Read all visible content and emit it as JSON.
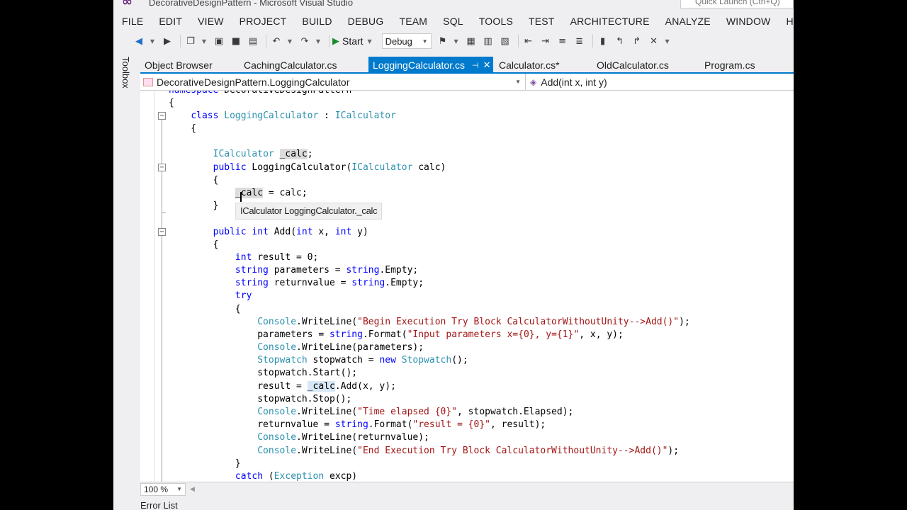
{
  "window": {
    "title": "DecorativeDesignPattern - Microsoft Visual Studio",
    "quick_launch_placeholder": "Quick Launch (Ctrl+Q)"
  },
  "menu": [
    "FILE",
    "EDIT",
    "VIEW",
    "PROJECT",
    "BUILD",
    "DEBUG",
    "TEAM",
    "SQL",
    "TOOLS",
    "TEST",
    "ARCHITECTURE",
    "ANALYZE",
    "WINDOW",
    "HELP"
  ],
  "toolbar": {
    "start_label": "Start",
    "configuration": "Debug"
  },
  "toolbox": {
    "label": "Toolbox"
  },
  "tabs": [
    {
      "label": "Object Browser",
      "active": false
    },
    {
      "label": "CachingCalculator.cs",
      "active": false
    },
    {
      "label": "LoggingCalculator.cs",
      "active": true
    },
    {
      "label": "Calculator.cs*",
      "active": false
    },
    {
      "label": "OldCalculator.cs",
      "active": false
    },
    {
      "label": "Program.cs",
      "active": false
    }
  ],
  "navbar": {
    "type_selector": "DecorativeDesignPattern.LoggingCalculator",
    "member_selector": "Add(int x, int y)"
  },
  "editor": {
    "lines": [
      "namespace DecorativeDesignPattern",
      "{",
      "    class LoggingCalculator : ICalculator",
      "    {",
      "",
      "        ICalculator _calc;",
      "        public LoggingCalculator(ICalculator calc)",
      "        {",
      "            _calc = calc;",
      "        }",
      "",
      "        public int Add(int x, int y)",
      "        {",
      "            int result = 0;",
      "            string parameters = string.Empty;",
      "            string returnvalue = string.Empty;",
      "            try",
      "            {",
      "                Console.WriteLine(\"Begin Execution Try Block CalculatorWithoutUnity-->Add()\");",
      "                parameters = string.Format(\"Input parameters x={0}, y={1}\", x, y);",
      "                Console.WriteLine(parameters);",
      "                Stopwatch stopwatch = new Stopwatch();",
      "                stopwatch.Start();",
      "                result = _calc.Add(x, y);",
      "                stopwatch.Stop();",
      "                Console.WriteLine(\"Time elapsed {0}\", stopwatch.Elapsed);",
      "                returnvalue = string.Format(\"result = {0}\", result);",
      "                Console.WriteLine(returnvalue);",
      "                Console.WriteLine(\"End Execution Try Block CalculatorWithoutUnity-->Add()\");",
      "            }",
      "            catch (Exception excp)"
    ],
    "tooltip": "ICalculator LoggingCalculator._calc"
  },
  "statusbar": {
    "zoom": "100 %",
    "error_list_tab": "Error List"
  },
  "colors": {
    "keyword": "#0000FF",
    "type": "#2B91AF",
    "string": "#A31515",
    "accent": "#007ACC"
  }
}
